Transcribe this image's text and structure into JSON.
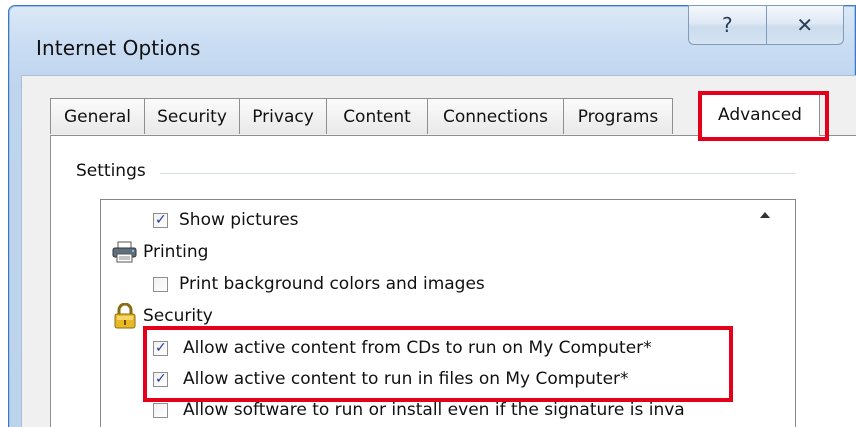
{
  "window": {
    "title": "Internet Options",
    "help_icon": "?",
    "close_icon": "✕"
  },
  "tabs": [
    {
      "label": "General"
    },
    {
      "label": "Security"
    },
    {
      "label": "Privacy"
    },
    {
      "label": "Content"
    },
    {
      "label": "Connections"
    },
    {
      "label": "Programs"
    },
    {
      "label": "Advanced",
      "selected": true
    }
  ],
  "settings": {
    "group_label": "Settings",
    "items": [
      {
        "type": "checkbox",
        "label": "Show pictures",
        "checked": true
      },
      {
        "type": "category",
        "label": "Printing",
        "icon": "printer-icon"
      },
      {
        "type": "checkbox",
        "label": "Print background colors and images",
        "checked": false
      },
      {
        "type": "category",
        "label": "Security",
        "icon": "lock-icon"
      },
      {
        "type": "checkbox",
        "label": "Allow active content from CDs to run on My Computer*",
        "checked": true
      },
      {
        "type": "checkbox",
        "label": "Allow active content to run in files on My Computer*",
        "checked": true
      },
      {
        "type": "checkbox",
        "label": "Allow software to run or install even if the signature is inva",
        "checked": false
      }
    ]
  },
  "highlight_color": "#e4001b"
}
